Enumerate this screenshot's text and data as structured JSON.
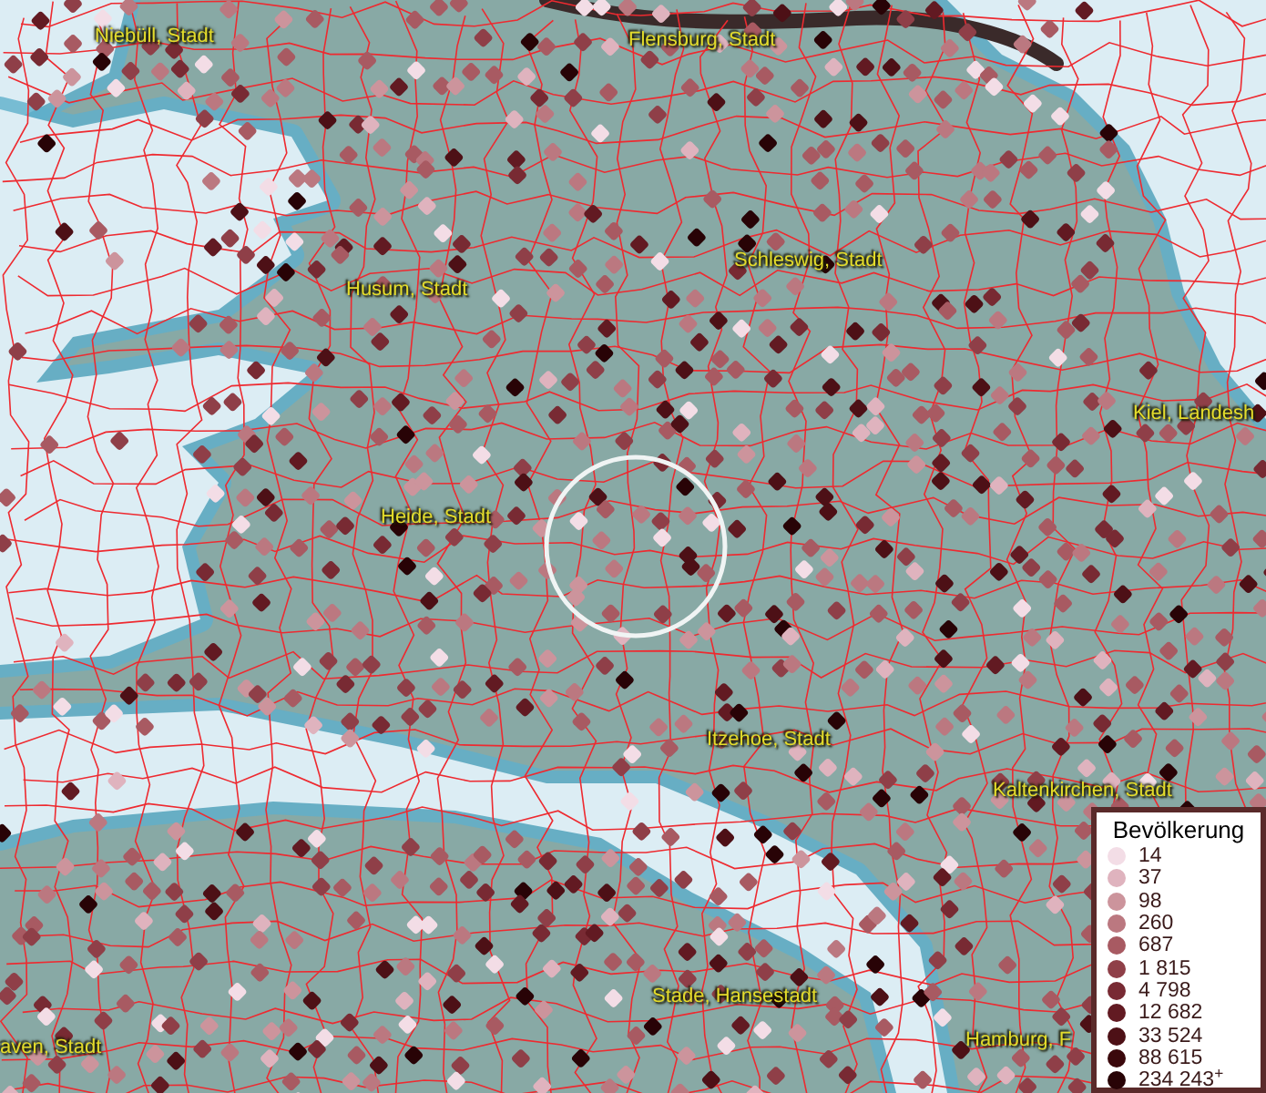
{
  "map": {
    "place_labels": [
      {
        "text": "Niebüll, Stadt"
      },
      {
        "text": "Flensburg, Stadt"
      },
      {
        "text": "Husum, Stadt"
      },
      {
        "text": "Schleswig, Stadt"
      },
      {
        "text": "Kiel, Landesh"
      },
      {
        "text": "Heide, Stadt"
      },
      {
        "text": "Itzehoe, Stadt"
      },
      {
        "text": "Kaltenkirchen, Stadt"
      },
      {
        "text": "Stade, Hansestadt"
      },
      {
        "text": "Hamburg, F"
      },
      {
        "text": "aven, Stadt"
      }
    ]
  },
  "legend": {
    "title": "Bevölkerung",
    "items": [
      {
        "label": "14",
        "color": "#f3dde6"
      },
      {
        "label": "37",
        "color": "#dfb3be"
      },
      {
        "label": "98",
        "color": "#cc949c"
      },
      {
        "label": "260",
        "color": "#bb7880"
      },
      {
        "label": "687",
        "color": "#a85a62"
      },
      {
        "label": "1 815",
        "color": "#8f3f48"
      },
      {
        "label": "4 798",
        "color": "#782a33"
      },
      {
        "label": "12 682",
        "color": "#621a22"
      },
      {
        "label": "33 524",
        "color": "#4d1016"
      },
      {
        "label": "88 615",
        "color": "#3b080c"
      },
      {
        "label": "234 243$^{+}$",
        "color": "#280306"
      }
    ]
  }
}
